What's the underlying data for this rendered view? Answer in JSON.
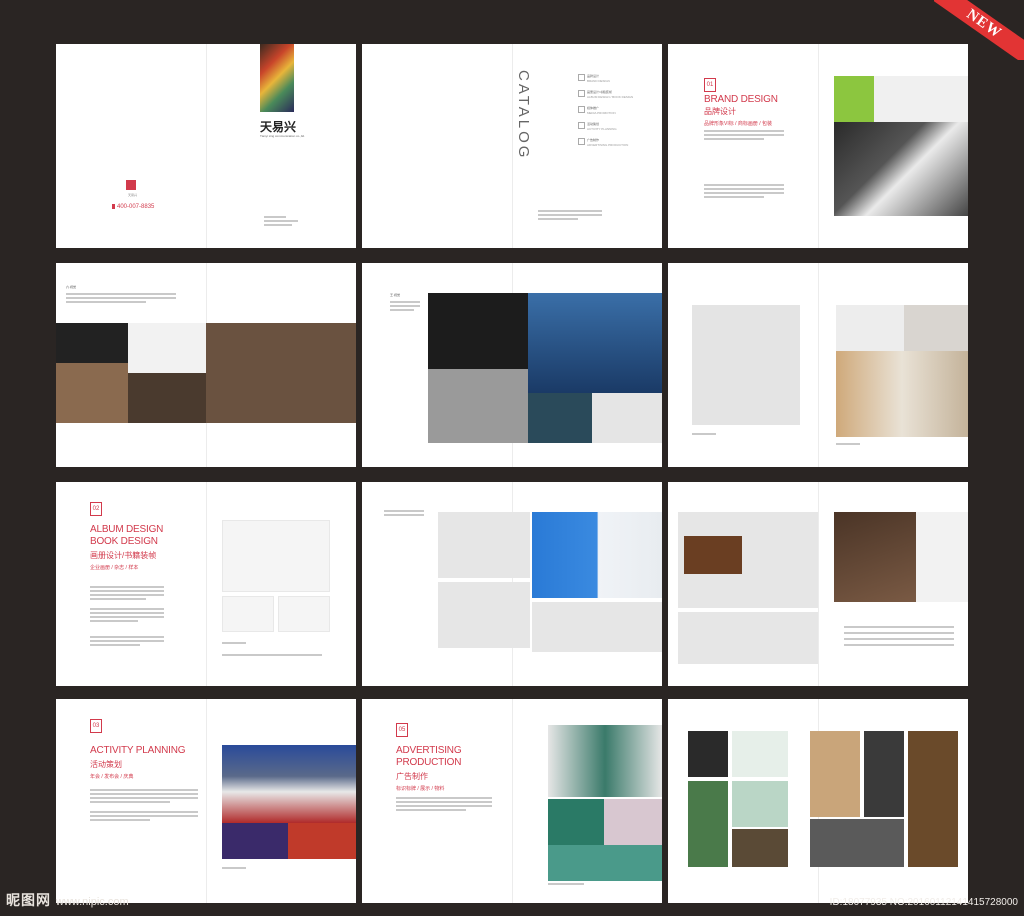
{
  "badge": {
    "label": "NEW"
  },
  "cover": {
    "brand_cn": "天易兴",
    "tagline": "Tianyi xing communication co.,ltd.",
    "phone": "400-007-8835",
    "mini_logo": "天易兴"
  },
  "catalog": {
    "title": "CATALOG",
    "items": [
      {
        "cn": "品牌设计",
        "en": "BRAND DESIGN"
      },
      {
        "cn": "画册设计/书籍装帧",
        "en": "ALBUM DESIGN / BOOK DESIGN"
      },
      {
        "cn": "媒体推广",
        "en": "MEDIA PROMOTION"
      },
      {
        "cn": "活动策划",
        "en": "ACTIVITY PLANNING"
      },
      {
        "cn": "广告制作",
        "en": "ADVERTISING PRODUCTION"
      }
    ]
  },
  "brand": {
    "num": "01",
    "title": "BRAND DESIGN",
    "cn": "品牌设计",
    "sub": "品牌形象VI标 / 商标画册 / 包装"
  },
  "sections": [
    {
      "num": "02",
      "title_l1": "ALBUM DESIGN",
      "title_l2": "BOOK DESIGN",
      "cn": "画册设计/书籍装帧",
      "sub": "企业画册 / 杂志 / 样本"
    },
    {
      "num": "03",
      "title_l1": "ACTIVITY PLANNING",
      "title_l2": "",
      "cn": "活动策划",
      "sub": "年会 / 发布会 / 庆典"
    },
    {
      "num": "05",
      "title_l1": "ADVERTISING",
      "title_l2": "PRODUCTION",
      "cn": "广告制作",
      "sub": "标识标牌 / 展示 / 物料"
    }
  ],
  "captions": {
    "vi": "六·视觉",
    "wang": "王·视觉"
  },
  "footer": {
    "logo": "昵图网",
    "url": "www.nipic.com",
    "id_text": "ID:18077935 NO:20160112141415728000"
  },
  "colors": {
    "accent": "#d23a4c",
    "background": "#2a2523",
    "badge": "#e23434",
    "lime": "#8cc63f"
  }
}
